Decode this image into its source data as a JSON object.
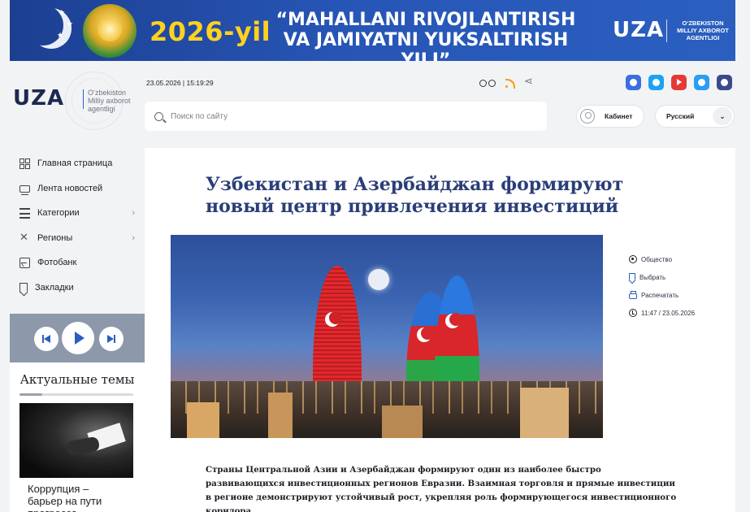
{
  "banner": {
    "year": "2026-yil",
    "slogan": "“MAHALLANI RIVOJLANTIRISH VA JAMIYATNI YUKSALTIRISH YILI”",
    "logo": "UZA",
    "agency": "O‘ZBEKISTON MILLIY AXBOROT AGENTLIGI"
  },
  "logo": {
    "word": "UZA",
    "subtitle": "O‘zbekiston Milliy axborot agentligi"
  },
  "header": {
    "datetime": "23.05.2026 | 15:19:29",
    "search_placeholder": "Поиск по сайту",
    "cabinet": "Кабинет",
    "language": "Русский"
  },
  "menu": {
    "items": [
      {
        "label": "Главная страница",
        "icon": "grid-icon",
        "has_submenu": false
      },
      {
        "label": "Лента новостей",
        "icon": "feed-icon",
        "has_submenu": false
      },
      {
        "label": "Категории",
        "icon": "list-icon",
        "has_submenu": true
      },
      {
        "label": "Регионы",
        "icon": "regions-icon",
        "has_submenu": true
      },
      {
        "label": "Фотобанк",
        "icon": "photo-icon",
        "has_submenu": false
      },
      {
        "label": "Закладки",
        "icon": "bookmark-icon",
        "has_submenu": false
      }
    ]
  },
  "sidebar": {
    "topics_title": "Актуальные темы",
    "topic_caption": "Коррупция – барьер на пути прогресса"
  },
  "article": {
    "headline": "Узбекистан и Азербайджан формируют новый центр привлечения инвестиций",
    "category": "Общество",
    "bookmark": "Выбрать",
    "print": "Распечатать",
    "time": "11:47 / 23.05.2026",
    "lead": "Страны Центральной Азии и Азербайджан формируют один из наиболее быстро развивающихся инвестиционных регионов Евразии. Взаимная торговля и прямые инвестиции в регионе демонстрируют устойчивый рост, укрепляя роль формирующегося инвестиционного коридора."
  },
  "colors": {
    "accent": "#2a5fc0",
    "banner_year": "#ffd21f",
    "headline": "#2a3e78"
  }
}
